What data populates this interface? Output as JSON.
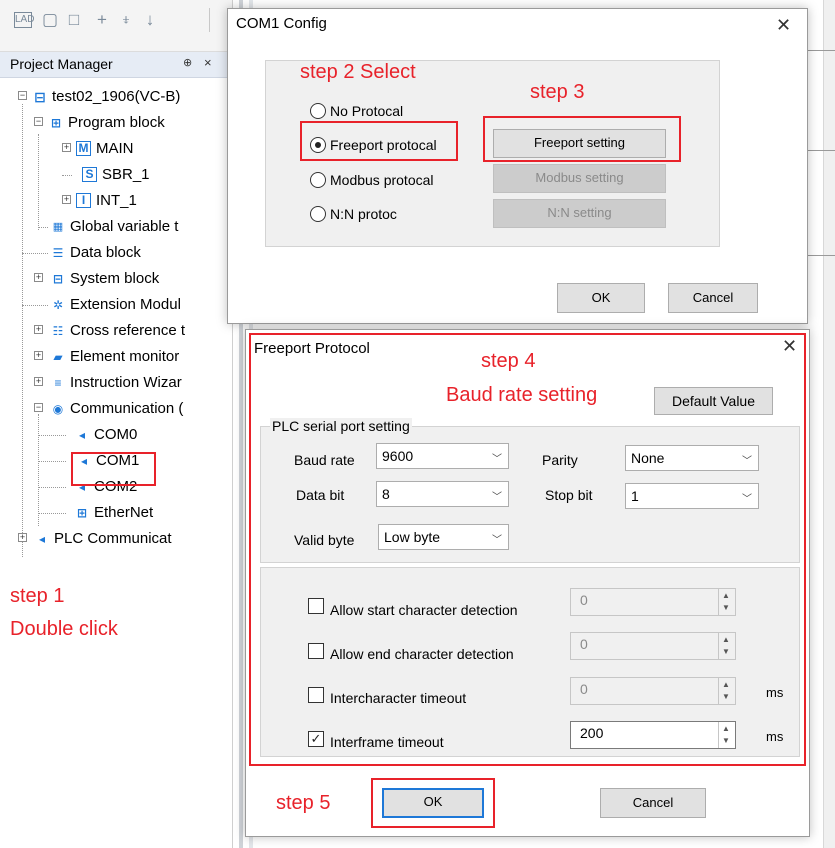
{
  "project_manager": {
    "title": "Project Manager",
    "pin_glyph": "()",
    "close_glyph": "×",
    "tree": {
      "root": "test02_1906(VC-B)",
      "program_block": "Program block",
      "main": "MAIN",
      "sbr": "SBR_1",
      "int": "INT_1",
      "global_var": "Global variable t",
      "data_block": "Data block",
      "system_block": "System block",
      "extension": "Extension Modul",
      "cross_ref": "Cross reference t",
      "element_monitor": "Element monitor",
      "instruction_wizard": "Instruction Wizar",
      "communication": "Communication (",
      "com0": "COM0",
      "com1": "COM1",
      "com2": "COM2",
      "ethernet": "EtherNet",
      "plc_comm": "PLC Communicat"
    }
  },
  "annotations": {
    "step1_line1": "step 1",
    "step1_line2": "Double click",
    "step2": "step 2 Select",
    "step3": "step 3",
    "step4_line1": "step 4",
    "step4_line2": "Baud rate setting",
    "step5": "step 5"
  },
  "com1_dialog": {
    "title": "COM1 Config",
    "close": "✕",
    "radios": [
      "No Protocal",
      "Freeport protocal",
      "Modbus protocal",
      "N:N protoc"
    ],
    "selected_index": 1,
    "freeport_setting": "Freeport setting",
    "modbus_setting": "Modbus setting",
    "nn_setting": "N:N setting",
    "ok": "OK",
    "cancel": "Cancel"
  },
  "freeport_dialog": {
    "title": "Freeport Protocol",
    "close": "✕",
    "default_value": "Default Value",
    "group_title": "PLC serial port setting",
    "baud_rate_label": "Baud rate",
    "baud_rate": "9600",
    "parity_label": "Parity",
    "parity": "None",
    "data_bit_label": "Data bit",
    "data_bit": "8",
    "stop_bit_label": "Stop bit",
    "stop_bit": "1",
    "valid_byte_label": "Valid byte",
    "valid_byte": "Low byte",
    "options": [
      {
        "label": "Allow start character detection",
        "checked": false,
        "value": "0",
        "unit": ""
      },
      {
        "label": "Allow end character detection",
        "checked": false,
        "value": "0",
        "unit": ""
      },
      {
        "label": "Intercharacter timeout",
        "checked": false,
        "value": "0",
        "unit": "ms"
      },
      {
        "label": "Interframe timeout",
        "checked": true,
        "value": "200",
        "unit": "ms"
      }
    ],
    "ok": "OK",
    "cancel": "Cancel"
  },
  "colors": {
    "annotation_red": "#e8222a",
    "focus_blue": "#1e78d7",
    "panel_header": "#e6ecf5"
  }
}
